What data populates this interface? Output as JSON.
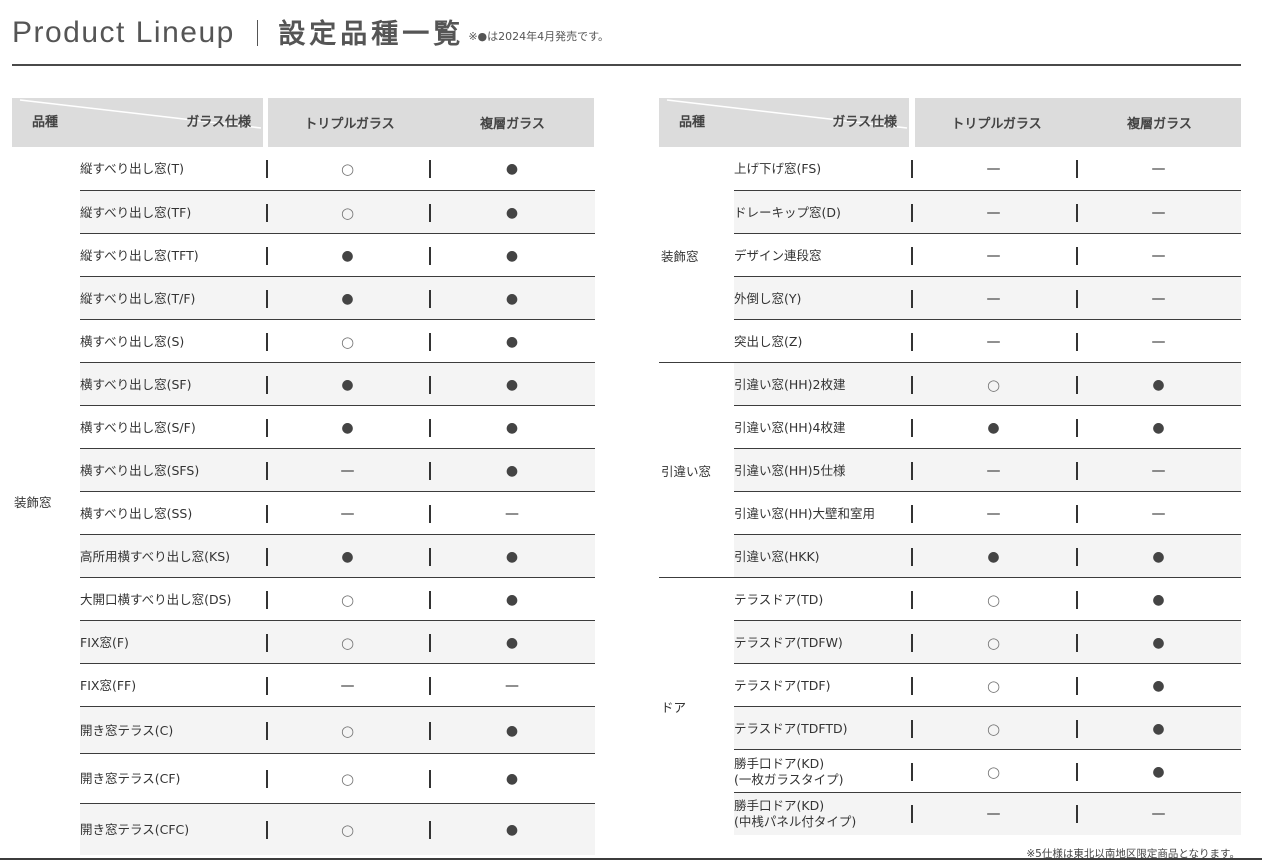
{
  "header": {
    "title_en": "Product Lineup",
    "title_ja": "設定品種一覧",
    "note": "※●は2024年4月発売です。"
  },
  "table_header": {
    "row_label": "品種",
    "col_label": "ガラス仕様",
    "col1": "トリプルガラス",
    "col2": "複層ガラス"
  },
  "left_table": {
    "groups": [
      {
        "label": "装飾窓",
        "rows": [
          {
            "name": "縦すべり出し窓(T)",
            "triple": "○",
            "double": "●"
          },
          {
            "name": "縦すべり出し窓(TF)",
            "triple": "○",
            "double": "●"
          },
          {
            "name": "縦すべり出し窓(TFT)",
            "triple": "●",
            "double": "●"
          },
          {
            "name": "縦すべり出し窓(T/F)",
            "triple": "●",
            "double": "●"
          },
          {
            "name": "横すべり出し窓(S)",
            "triple": "○",
            "double": "●"
          },
          {
            "name": "横すべり出し窓(SF)",
            "triple": "●",
            "double": "●"
          },
          {
            "name": "横すべり出し窓(S/F)",
            "triple": "●",
            "double": "●"
          },
          {
            "name": "横すべり出し窓(SFS)",
            "triple": "—",
            "double": "●"
          },
          {
            "name": "横すべり出し窓(SS)",
            "triple": "—",
            "double": "—"
          },
          {
            "name": "高所用横すべり出し窓(KS)",
            "triple": "●",
            "double": "●"
          },
          {
            "name": "大開口横すべり出し窓(DS)",
            "triple": "○",
            "double": "●"
          },
          {
            "name": "FIX窓(F)",
            "triple": "○",
            "double": "●"
          },
          {
            "name": "FIX窓(FF)",
            "triple": "—",
            "double": "—"
          },
          {
            "name": "開き窓テラス(C)",
            "triple": "○",
            "double": "●"
          },
          {
            "name": "開き窓テラス(CF)",
            "triple": "○",
            "double": "●"
          },
          {
            "name": "開き窓テラス(CFC)",
            "triple": "○",
            "double": "●"
          }
        ]
      }
    ]
  },
  "right_table": {
    "groups": [
      {
        "label": "装飾窓",
        "rows": [
          {
            "name": "上げ下げ窓(FS)",
            "triple": "—",
            "double": "—"
          },
          {
            "name": "ドレーキップ窓(D)",
            "triple": "—",
            "double": "—"
          },
          {
            "name": "デザイン連段窓",
            "triple": "—",
            "double": "—"
          },
          {
            "name": "外倒し窓(Y)",
            "triple": "—",
            "double": "—"
          },
          {
            "name": "突出し窓(Z)",
            "triple": "—",
            "double": "—"
          }
        ]
      },
      {
        "label": "引違い窓",
        "rows": [
          {
            "name": "引違い窓(HH)2枚建",
            "triple": "○",
            "double": "●"
          },
          {
            "name": "引違い窓(HH)4枚建",
            "triple": "●",
            "double": "●"
          },
          {
            "name": "引違い窓(HH)5仕様",
            "triple": "—",
            "double": "—"
          },
          {
            "name": "引違い窓(HH)大壁和室用",
            "triple": "—",
            "double": "—"
          },
          {
            "name": "引違い窓(HKK)",
            "triple": "●",
            "double": "●"
          }
        ]
      },
      {
        "label": "ドア",
        "rows": [
          {
            "name": "テラスドア(TD)",
            "triple": "○",
            "double": "●"
          },
          {
            "name": "テラスドア(TDFW)",
            "triple": "○",
            "double": "●"
          },
          {
            "name": "テラスドア(TDF)",
            "triple": "○",
            "double": "●"
          },
          {
            "name": "テラスドア(TDFTD)",
            "triple": "○",
            "double": "●"
          },
          {
            "name": "勝手口ドア(KD)\n(一枚ガラスタイプ)",
            "triple": "○",
            "double": "●"
          },
          {
            "name": "勝手口ドア(KD)\n(中桟パネル付タイプ)",
            "triple": "—",
            "double": "—"
          }
        ]
      }
    ]
  },
  "footnote": "※5仕様は東北以南地区限定商品となります。"
}
